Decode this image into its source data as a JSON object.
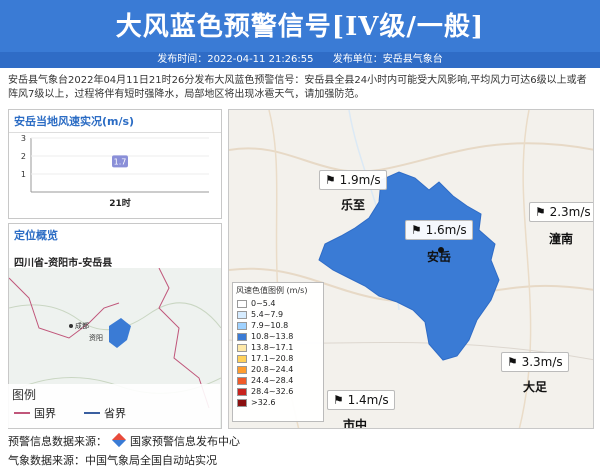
{
  "header": {
    "title": "大风蓝色预警信号[IV级/一般]",
    "publish_time": "发布时间：2022-04-11 21:26:55",
    "publisher": "发布单位：安岳县气象台"
  },
  "message": "安岳县气象台2022年04月11日21时26分发布大风蓝色预警信号：安岳县全县24小时内可能受大风影响,平均风力可达6级以上或者阵风7级以上，过程将伴有短时强降水，局部地区将出现冰雹天气，请加强防范。",
  "wind_panel": {
    "title": "安岳当地风速实况(m/s)"
  },
  "chart_data": {
    "type": "bar",
    "categories": [
      "21时"
    ],
    "values": [
      1.7
    ],
    "ylim": [
      0,
      3
    ],
    "yticks": [
      1,
      2,
      3
    ],
    "data_labels": [
      "1.7"
    ]
  },
  "location_panel": {
    "title": "定位概览",
    "path": "四川省-资阳市-安岳县",
    "cities": [
      "成都",
      "资阳"
    ]
  },
  "mini_legend": {
    "title": "图例",
    "items": [
      {
        "label": "国界",
        "color": "#c0567a"
      },
      {
        "label": "省界",
        "color": "#3a5fa0"
      }
    ]
  },
  "map": {
    "labels": [
      {
        "name": "乐至"
      },
      {
        "name": "安岳"
      },
      {
        "name": "潼南"
      },
      {
        "name": "大足"
      },
      {
        "name": "市中"
      }
    ],
    "wind_readings": [
      {
        "value": "1.9m/s"
      },
      {
        "value": "1.6m/s"
      },
      {
        "value": "2.3m/s"
      },
      {
        "value": "3.3m/s"
      },
      {
        "value": "1.4m/s"
      }
    ],
    "scale_title": "风速色值图例 (m/s)",
    "scale": [
      {
        "label": "0~5.4",
        "color": "#ffffff"
      },
      {
        "label": "5.4~7.9",
        "color": "#d6ecff"
      },
      {
        "label": "7.9~10.8",
        "color": "#9fd2ff"
      },
      {
        "label": "10.8~13.8",
        "color": "#3a7bd5"
      },
      {
        "label": "13.8~17.1",
        "color": "#ffe9a8"
      },
      {
        "label": "17.1~20.8",
        "color": "#ffd15a"
      },
      {
        "label": "20.8~24.4",
        "color": "#ff9c2e"
      },
      {
        "label": "24.4~28.4",
        "color": "#f05a28"
      },
      {
        "label": "28.4~32.6",
        "color": "#c8231e"
      },
      {
        "label": ">32.6",
        "color": "#8a0f0f"
      }
    ]
  },
  "footer": {
    "source1": "预警信息数据来源：",
    "source1_org": "国家预警信息发布中心",
    "source2": "气象数据来源：中国气象局全国自动站实况"
  }
}
